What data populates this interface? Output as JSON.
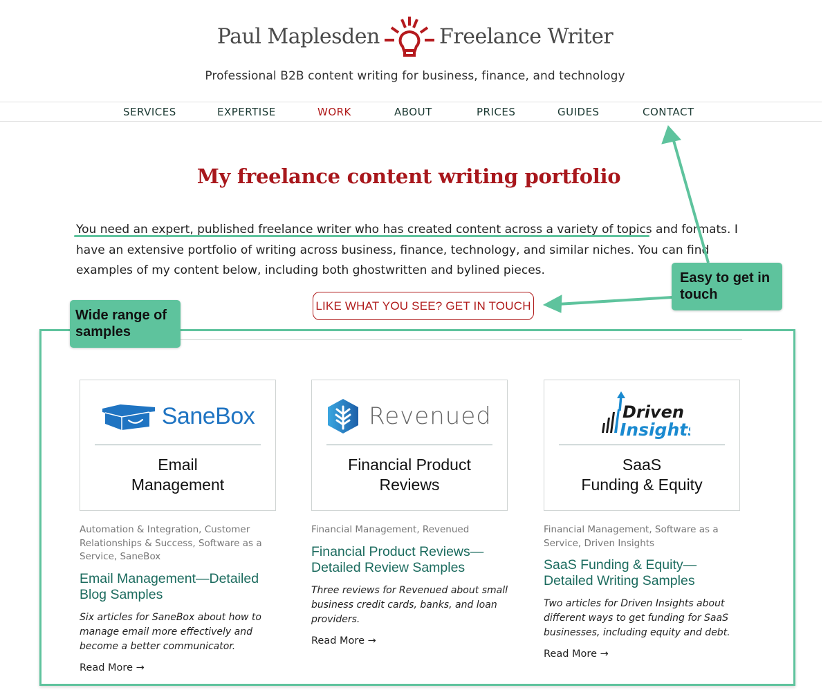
{
  "header": {
    "name_left": "Paul Maplesden",
    "name_right": "Freelance Writer",
    "logo_icon": "lightbulb-icon",
    "tagline": "Professional B2B content writing for business, finance, and technology"
  },
  "nav": {
    "items": [
      {
        "label": "SERVICES",
        "active": false
      },
      {
        "label": "EXPERTISE",
        "active": false
      },
      {
        "label": "WORK",
        "active": true
      },
      {
        "label": "ABOUT",
        "active": false
      },
      {
        "label": "PRICES",
        "active": false
      },
      {
        "label": "GUIDES",
        "active": false
      },
      {
        "label": "CONTACT",
        "active": false
      }
    ]
  },
  "main": {
    "title": "My freelance content writing portfolio",
    "intro_lines": [
      "You need an expert, published freelance writer who has created content across a variety of topics and formats. I",
      "have an extensive portfolio of writing across business, finance, technology, and similar niches. You can find",
      "examples of my content below, including both ghostwritten and bylined pieces."
    ],
    "cta_label": "LIKE WHAT YOU SEE? GET IN TOUCH"
  },
  "annotations": {
    "samples": "Wide range of samples",
    "touch": "Easy to get in touch",
    "color": "#5ec39d"
  },
  "cards": [
    {
      "logo": "SaneBox",
      "logo_icon": "sanebox-box-icon",
      "caption_1": "Email",
      "caption_2": "Management",
      "categories": "Automation & Integration, Customer Relationships & Success, Software as a Service, SaneBox",
      "title": "Email Management—Detailed Blog Samples",
      "description": "Six articles for SaneBox about how to manage email more effectively and become a better communicator.",
      "read_more": "Read More →"
    },
    {
      "logo": "Revenued",
      "logo_icon": "revenued-hexagon-icon",
      "caption_1": "Financial Product",
      "caption_2": "Reviews",
      "categories": "Financial Management, Revenued",
      "title": "Financial Product Reviews—Detailed Review Samples",
      "description": "Three reviews for Revenued about small business credit cards, banks, and loan providers.",
      "read_more": "Read More →"
    },
    {
      "logo_line1": "Driven",
      "logo_line2": "Insights",
      "logo_icon": "driven-insights-bars-icon",
      "caption_1": "SaaS",
      "caption_2": "Funding & Equity",
      "categories": "Financial Management, Software as a Service, Driven Insights",
      "title": "SaaS Funding & Equity—Detailed Writing Samples",
      "description": "Two articles for Driven Insights about different ways to get funding for SaaS businesses, including equity and debt.",
      "read_more": "Read More →"
    }
  ],
  "colors": {
    "brand_red": "#a8171c",
    "nav_text": "#1c3a33",
    "link_green": "#1b6b5e",
    "annotation_green": "#5ec39d"
  }
}
